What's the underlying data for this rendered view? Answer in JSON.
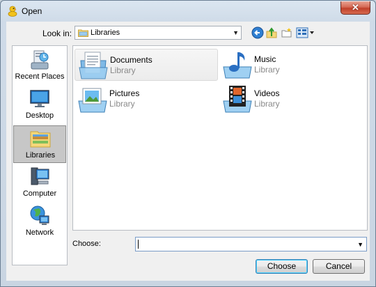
{
  "window": {
    "title": "Open",
    "close_label": "✕"
  },
  "toolbar": {
    "look_in_label": "Look in:",
    "look_in_value": "Libraries",
    "buttons": [
      "back",
      "up-one-level",
      "create-new-folder",
      "view-menu"
    ]
  },
  "places": [
    {
      "label": "Recent Places",
      "icon": "recent-places-icon"
    },
    {
      "label": "Desktop",
      "icon": "desktop-icon"
    },
    {
      "label": "Libraries",
      "icon": "libraries-icon",
      "selected": true
    },
    {
      "label": "Computer",
      "icon": "computer-icon"
    },
    {
      "label": "Network",
      "icon": "network-icon"
    }
  ],
  "files": [
    {
      "name": "Documents",
      "type": "Library",
      "icon": "documents-library-icon",
      "highlighted": true
    },
    {
      "name": "Music",
      "type": "Library",
      "icon": "music-library-icon"
    },
    {
      "name": "Pictures",
      "type": "Library",
      "icon": "pictures-library-icon"
    },
    {
      "name": "Videos",
      "type": "Library",
      "icon": "videos-library-icon"
    }
  ],
  "footer": {
    "choose_label": "Choose:",
    "choose_value": "",
    "ok_label": "Choose",
    "cancel_label": "Cancel"
  },
  "colors": {
    "accent": "#3c7fb1",
    "close": "#c7412b",
    "selected_place": "#c7c7c7"
  }
}
